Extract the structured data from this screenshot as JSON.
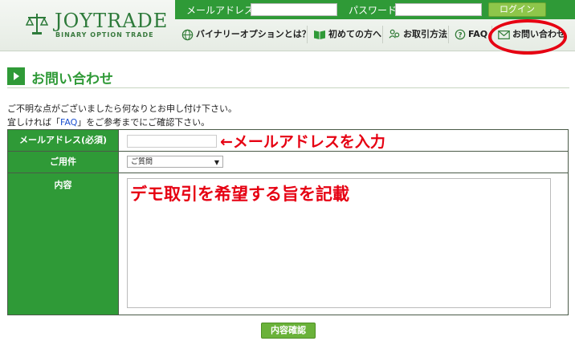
{
  "header": {
    "logo_name": "JOYTRADE",
    "logo_sub": "BINARY OPTION TRADE",
    "email_label": "メールアドレス",
    "password_label": "パスワード",
    "login_label": "ログイン"
  },
  "nav": {
    "items": [
      {
        "label": "バイナリーオプションとは？",
        "icon": "globe-icon"
      },
      {
        "label": "初めての方へ",
        "icon": "book-icon"
      },
      {
        "label": "お取引方法",
        "icon": "people-icon"
      },
      {
        "label": "FAQ",
        "icon": "question-icon"
      },
      {
        "label": "お問い合わせ",
        "icon": "mail-icon"
      }
    ]
  },
  "page": {
    "title": "お問い合わせ",
    "desc_line1": "ご不明な点がございましたら何なりとお申し付け下さい。",
    "desc_line2_pre": "宜しければ「",
    "desc_link": "FAQ",
    "desc_line2_post": "」をご参考までにご確認下さい。"
  },
  "form": {
    "email_label": "メールアドレス(必須)",
    "subject_label": "ご用件",
    "subject_value": "ご質問",
    "content_label": "内容",
    "confirm_label": "内容確認"
  },
  "annotations": {
    "email_hint": "←メールアドレスを入力",
    "content_hint": "デモ取引を希望する旨を記載"
  },
  "colors": {
    "brand_green": "#2f9a37",
    "highlight_red": "#e60012",
    "link_blue": "#1a4fcf"
  }
}
